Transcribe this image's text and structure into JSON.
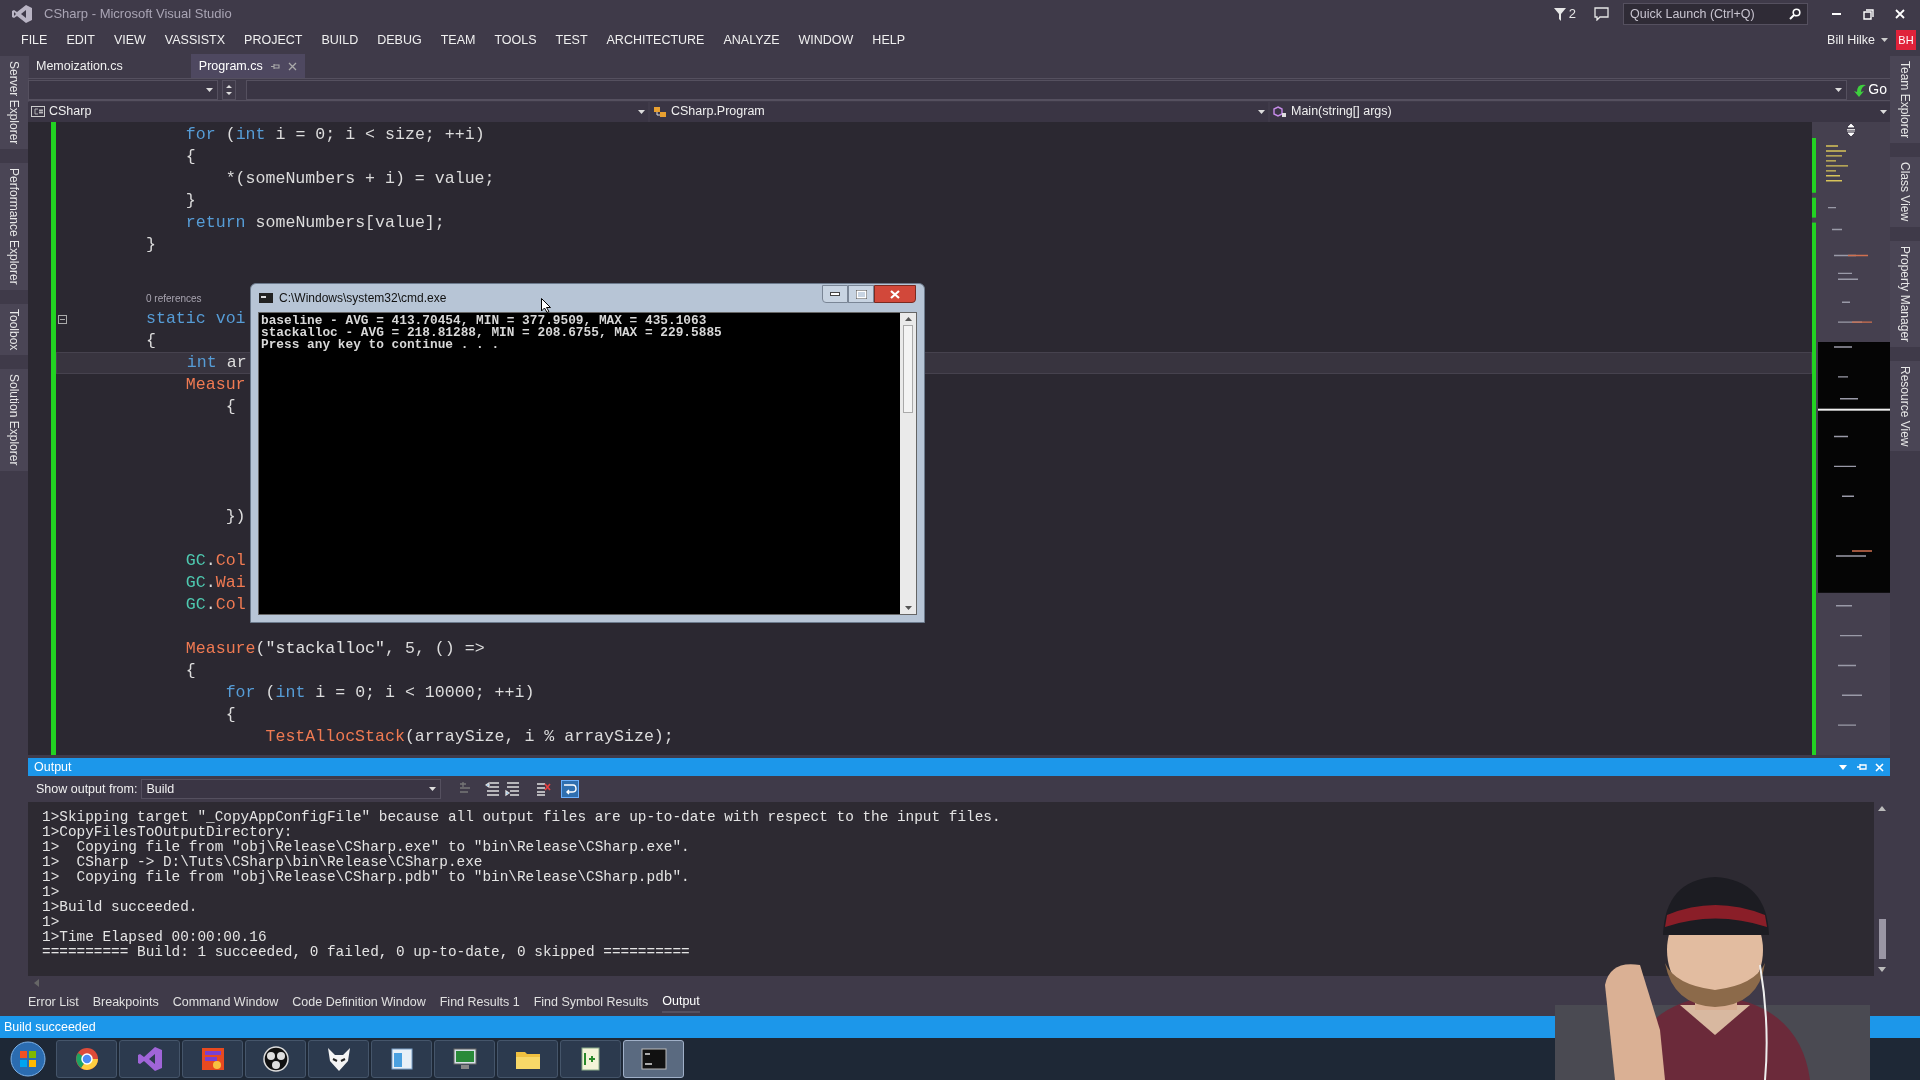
{
  "window": {
    "title": "CSharp - Microsoft Visual Studio"
  },
  "title_bar": {
    "notifications": "2",
    "quick_launch": {
      "placeholder": "Quick Launch (Ctrl+Q)"
    }
  },
  "menu": [
    "FILE",
    "EDIT",
    "VIEW",
    "VASSISTX",
    "PROJECT",
    "BUILD",
    "DEBUG",
    "TEAM",
    "TOOLS",
    "TEST",
    "ARCHITECTURE",
    "ANALYZE",
    "WINDOW",
    "HELP"
  ],
  "account": {
    "name": "Bill Hilke",
    "initials": "BH"
  },
  "left_tool_tabs": [
    "Server Explorer",
    "Performance Explorer",
    "Toolbox",
    "Solution Explorer"
  ],
  "right_tool_tabs": [
    "Team Explorer",
    "Class View",
    "Property Manager",
    "Resource View"
  ],
  "document_tabs": [
    {
      "label": "Memoization.cs",
      "selected": false
    },
    {
      "label": "Program.cs",
      "selected": true
    }
  ],
  "nav_bar": {
    "go_button": "Go",
    "project": "CSharp",
    "type": "CSharp.Program",
    "member": "Main(string[] args)"
  },
  "code_lines": [
    {
      "kind": "code",
      "current": false,
      "segments": [
        {
          "text": "    for",
          "kind": "kw"
        },
        {
          "text": " (",
          "kind": "p"
        },
        {
          "text": "int",
          "kind": "kw"
        },
        {
          "text": " i = 0; i < size; ++i)",
          "kind": "p"
        }
      ]
    },
    {
      "kind": "code",
      "current": false,
      "segments": [
        {
          "text": "    {",
          "kind": "p"
        }
      ]
    },
    {
      "kind": "code",
      "current": false,
      "segments": [
        {
          "text": "        *(someNumbers + i) = value;",
          "kind": "p"
        }
      ]
    },
    {
      "kind": "code",
      "current": false,
      "segments": [
        {
          "text": "    }",
          "kind": "p"
        }
      ]
    },
    {
      "kind": "code",
      "current": false,
      "segments": [
        {
          "text": "    return",
          "kind": "kw"
        },
        {
          "text": " someNumbers[value];",
          "kind": "p"
        }
      ]
    },
    {
      "kind": "code",
      "current": false,
      "segments": [
        {
          "text": "}",
          "kind": "p"
        }
      ]
    },
    {
      "kind": "blank"
    },
    {
      "kind": "codelens",
      "text": "0 references"
    },
    {
      "kind": "code",
      "current": false,
      "fold": true,
      "segments": [
        {
          "text": "static voi",
          "kind": "kw"
        }
      ]
    },
    {
      "kind": "code",
      "current": false,
      "segments": [
        {
          "text": "{",
          "kind": "p"
        }
      ]
    },
    {
      "kind": "code",
      "current": true,
      "segments": [
        {
          "text": "    int",
          "kind": "kw"
        },
        {
          "text": " ar",
          "kind": "p"
        }
      ]
    },
    {
      "kind": "code",
      "current": false,
      "segments": [
        {
          "text": "    Measur",
          "kind": "method"
        }
      ]
    },
    {
      "kind": "code",
      "current": false,
      "segments": [
        {
          "text": "        {",
          "kind": "p"
        }
      ]
    },
    {
      "kind": "blank"
    },
    {
      "kind": "blank"
    },
    {
      "kind": "blank"
    },
    {
      "kind": "blank"
    },
    {
      "kind": "code",
      "current": false,
      "segments": [
        {
          "text": "        })",
          "kind": "p"
        }
      ]
    },
    {
      "kind": "blank"
    },
    {
      "kind": "code",
      "current": false,
      "segments": [
        {
          "text": "    GC",
          "kind": "cls"
        },
        {
          "text": ".",
          "kind": "p"
        },
        {
          "text": "Col",
          "kind": "method"
        }
      ]
    },
    {
      "kind": "code",
      "current": false,
      "segments": [
        {
          "text": "    GC",
          "kind": "cls"
        },
        {
          "text": ".",
          "kind": "p"
        },
        {
          "text": "Wai",
          "kind": "method"
        }
      ]
    },
    {
      "kind": "code",
      "current": false,
      "segments": [
        {
          "text": "    GC",
          "kind": "cls"
        },
        {
          "text": ".",
          "kind": "p"
        },
        {
          "text": "Col",
          "kind": "method"
        }
      ]
    },
    {
      "kind": "blank"
    },
    {
      "kind": "code",
      "current": false,
      "segments": [
        {
          "text": "    Measure",
          "kind": "method"
        },
        {
          "text": "(",
          "kind": "p"
        },
        {
          "text": "\"stackalloc\"",
          "kind": "str"
        },
        {
          "text": ", 5, () =>",
          "kind": "p"
        }
      ]
    },
    {
      "kind": "code",
      "current": false,
      "segments": [
        {
          "text": "    {",
          "kind": "p"
        }
      ]
    },
    {
      "kind": "code",
      "current": false,
      "segments": [
        {
          "text": "        for",
          "kind": "kw"
        },
        {
          "text": " (",
          "kind": "p"
        },
        {
          "text": "int",
          "kind": "kw"
        },
        {
          "text": " i = 0; i < 10000; ++i)",
          "kind": "p"
        }
      ]
    },
    {
      "kind": "code",
      "current": false,
      "segments": [
        {
          "text": "        {",
          "kind": "p"
        }
      ]
    },
    {
      "kind": "code",
      "current": false,
      "segments": [
        {
          "text": "            TestAllocStack",
          "kind": "method"
        },
        {
          "text": "(arraySize, i % arraySize);",
          "kind": "p"
        }
      ]
    }
  ],
  "console": {
    "title": "C:\\Windows\\system32\\cmd.exe",
    "lines": [
      "baseline - AVG = 413.70454, MIN = 377.9509, MAX = 435.1063",
      "stackalloc - AVG = 218.81288, MIN = 208.6755, MAX = 229.5885",
      "Press any key to continue . . ."
    ]
  },
  "output": {
    "title": "Output",
    "source_label": "Show output from:",
    "source": "Build",
    "lines": [
      "1>Skipping target \"_CopyAppConfigFile\" because all output files are up-to-date with respect to the input files.",
      "1>CopyFilesToOutputDirectory:",
      "1>  Copying file from \"obj\\Release\\CSharp.exe\" to \"bin\\Release\\CSharp.exe\".",
      "1>  CSharp -> D:\\Tuts\\CSharp\\bin\\Release\\CSharp.exe",
      "1>  Copying file from \"obj\\Release\\CSharp.pdb\" to \"bin\\Release\\CSharp.pdb\".",
      "1>",
      "1>Build succeeded.",
      "1>",
      "1>Time Elapsed 00:00:00.16",
      "========== Build: 1 succeeded, 0 failed, 0 up-to-date, 0 skipped =========="
    ]
  },
  "bottom_tabs": [
    {
      "label": "Error List",
      "selected": false
    },
    {
      "label": "Breakpoints",
      "selected": false
    },
    {
      "label": "Command Window",
      "selected": false
    },
    {
      "label": "Code Definition Window",
      "selected": false
    },
    {
      "label": "Find Results 1",
      "selected": false
    },
    {
      "label": "Find Symbol Results",
      "selected": false
    },
    {
      "label": "Output",
      "selected": true
    }
  ],
  "status_bar": {
    "text": "Build succeeded"
  },
  "taskbar": {
    "apps": [
      {
        "kind": "browser",
        "selected": false
      },
      {
        "kind": "studio",
        "selected": false
      },
      {
        "kind": "paint",
        "selected": false
      },
      {
        "kind": "aperture",
        "selected": false
      },
      {
        "kind": "mask",
        "selected": false
      },
      {
        "kind": "window",
        "selected": false
      },
      {
        "kind": "monitor",
        "selected": false
      },
      {
        "kind": "folder",
        "selected": false
      },
      {
        "kind": "notepad",
        "selected": false
      },
      {
        "kind": "terminal",
        "selected": true
      }
    ]
  }
}
